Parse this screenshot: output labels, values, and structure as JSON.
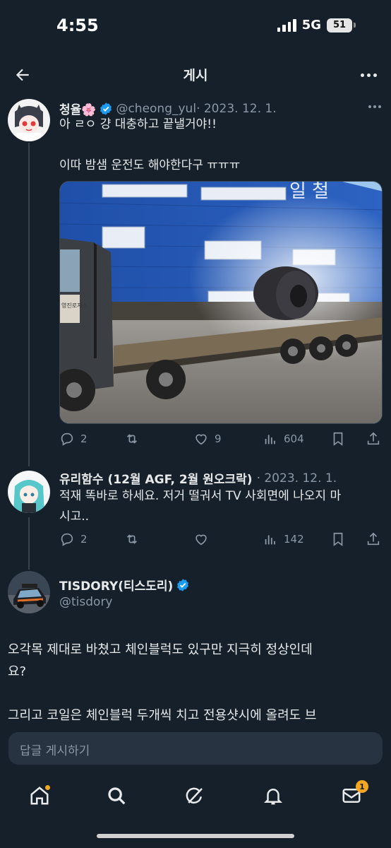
{
  "status_bar": {
    "time": "4:55",
    "network": "5G",
    "battery": "51"
  },
  "header": {
    "title": "게시"
  },
  "tweets": [
    {
      "display_name": "청율🌸",
      "handle": "@cheong_yul",
      "meta": "· 2023. 12. 1.",
      "text": "아 ㄹㅇ 걍 대충하고 끝낼거야!!\n\n이따 밤샘 운전도 해야한다구 ㅠㅠㅠ",
      "stats": {
        "replies": "2",
        "retweets": "",
        "likes": "9",
        "views": "604"
      },
      "media_sign": "일  철",
      "media_label": "영진로지스"
    },
    {
      "display_name": "유리함수 (12월 AGF, 2월 원오크락)",
      "meta": "· 2023. 12. 1.",
      "text": "적재 똑바로 하세요. 저거 떨궈서 TV 사회면에 나오지 마\n시고..",
      "stats": {
        "replies": "2",
        "retweets": "",
        "likes": "",
        "views": "142"
      }
    },
    {
      "display_name": "TISDORY(티스도리)",
      "handle": "@tisdory",
      "text": "오각목 제대로 바쳤고 체인블럭도 있구만 지극히 정상인데\n요?\n\n그리고 코일은 체인블럭 두개씩 치고 전용샷시에 올려도 브"
    }
  ],
  "reply_box": {
    "placeholder": "답글 게시하기"
  },
  "nav": {
    "messages_badge": "1"
  },
  "colors": {
    "background": "#15202b",
    "verified": "#1d9bf0",
    "badge": "#f5a623",
    "text_secondary": "#8b98a5"
  },
  "icons": [
    "back-arrow-icon",
    "more-icon",
    "verified-icon",
    "reply-icon",
    "retweet-icon",
    "like-icon",
    "views-icon",
    "bookmark-icon",
    "share-icon",
    "home-icon",
    "search-icon",
    "grok-icon",
    "notifications-icon",
    "messages-icon"
  ]
}
